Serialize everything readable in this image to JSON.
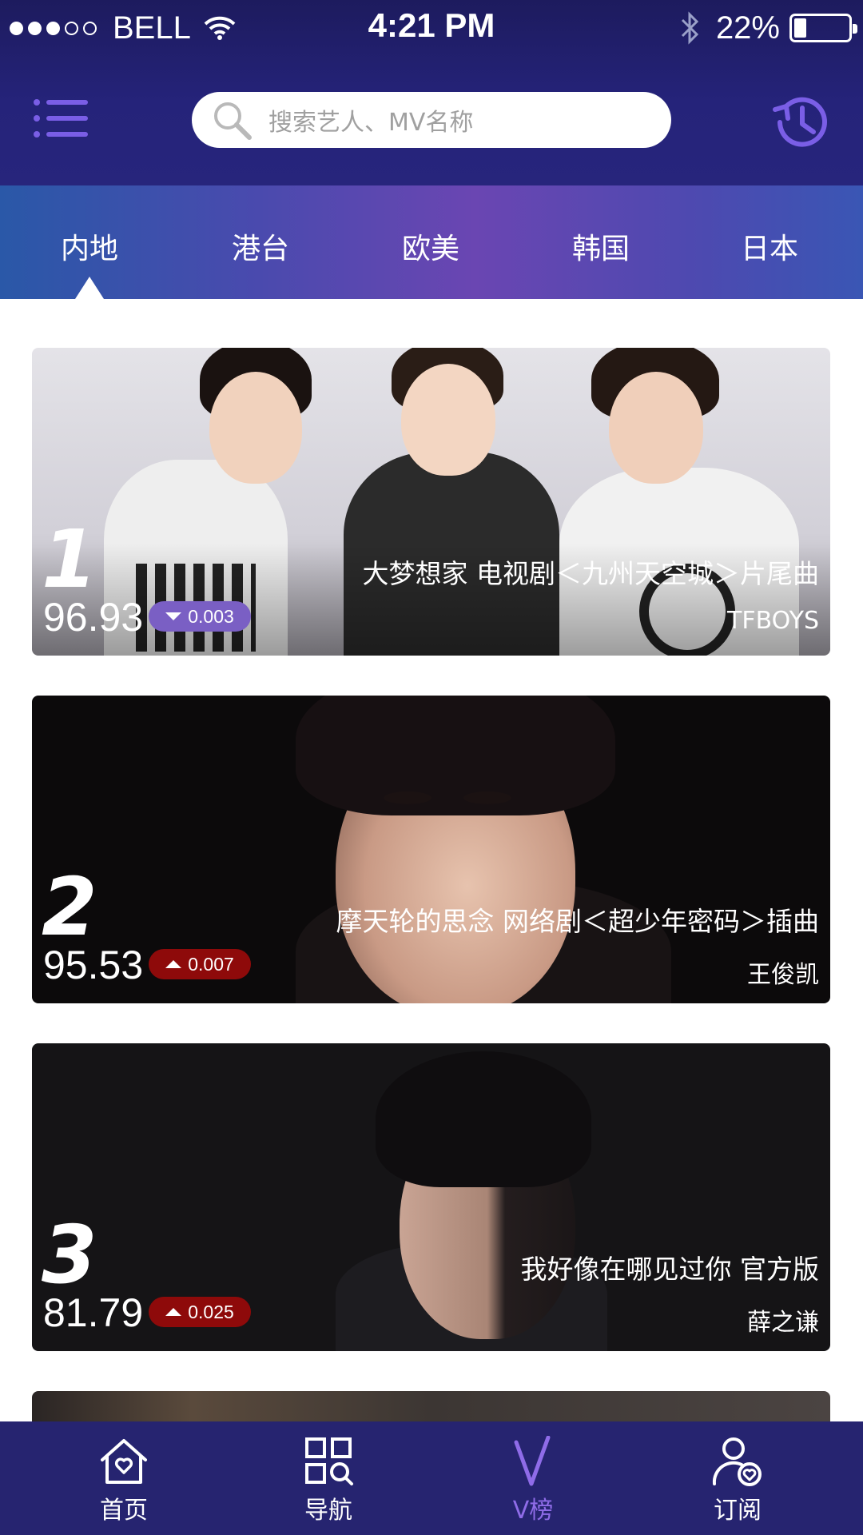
{
  "status_bar": {
    "carrier": "BELL",
    "time": "4:21 PM",
    "battery": "22%",
    "battery_level": 0.22,
    "signal_bars_filled": 3,
    "signal_bars_total": 5
  },
  "header": {
    "menu_icon": "menu-icon",
    "search": {
      "placeholder": "搜索艺人、MV名称",
      "icon": "search-icon"
    },
    "history_icon": "history-icon"
  },
  "tabs": {
    "items": [
      "内地",
      "港台",
      "欧美",
      "韩国",
      "日本"
    ],
    "selected_index": 0
  },
  "chart_list": [
    {
      "rank": "1",
      "score": "96.93",
      "change": "0.003",
      "trend": "down",
      "song": "大梦想家 电视剧＜九州天空城＞片尾曲",
      "artist": "TFBOYS"
    },
    {
      "rank": "2",
      "score": "95.53",
      "change": "0.007",
      "trend": "up",
      "song": "摩天轮的思念 网络剧＜超少年密码＞插曲",
      "artist": "王俊凯"
    },
    {
      "rank": "3",
      "score": "81.79",
      "change": "0.025",
      "trend": "up",
      "song": "我好像在哪见过你 官方版",
      "artist": "薛之谦"
    }
  ],
  "bottom_nav": {
    "items": [
      {
        "label": "首页",
        "icon": "home-heart-icon"
      },
      {
        "label": "导航",
        "icon": "grid-search-icon"
      },
      {
        "label": "V榜",
        "icon": "v-chart-icon"
      },
      {
        "label": "订阅",
        "icon": "user-heart-icon"
      }
    ],
    "active_index": 2
  },
  "colors": {
    "header_bg": "#1d1b5e",
    "accent": "#8f6ce8",
    "badge_down": "#7a5fc4",
    "badge_up": "#8e0a0a",
    "nav_bg": "#262470"
  }
}
